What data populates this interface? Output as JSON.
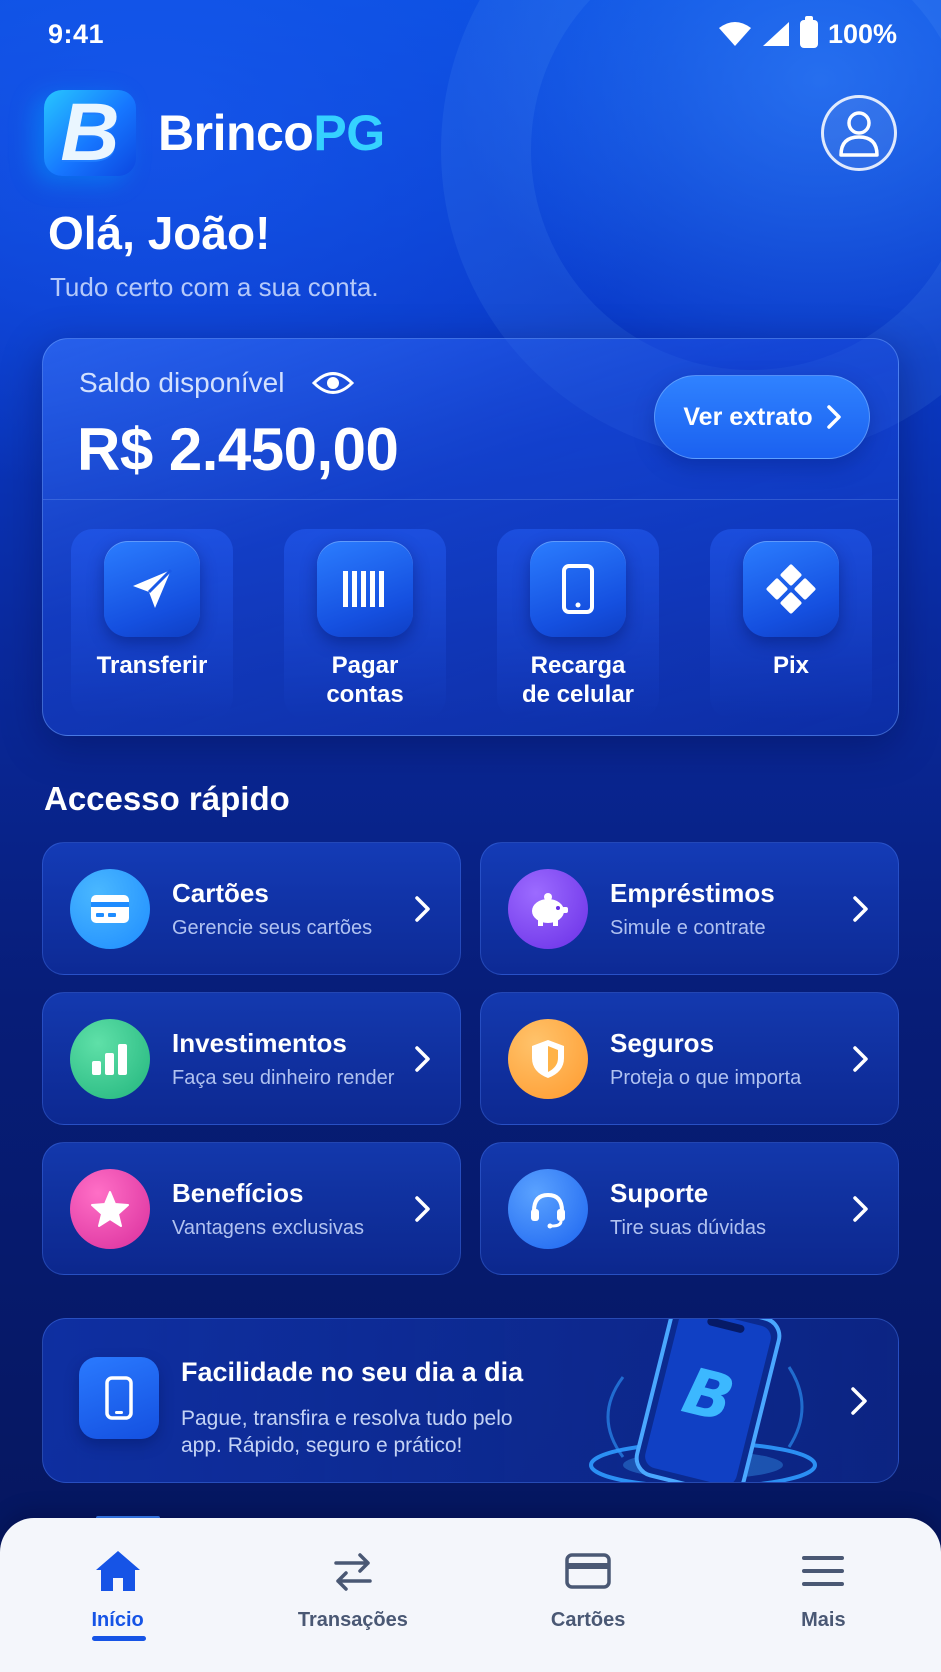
{
  "status_bar": {
    "time": "9:41",
    "battery": "100%"
  },
  "header": {
    "brand_main": "Brinco",
    "brand_accent": "PG",
    "logo_letter": "B"
  },
  "greeting": {
    "title": "Olá, João!",
    "subtitle": "Tudo certo com a sua conta."
  },
  "balance": {
    "label": "Saldo disponível",
    "value": "R$ 2.450,00",
    "statement_button": "Ver extrato"
  },
  "actions": [
    {
      "label": "Transferir",
      "icon": "send-icon"
    },
    {
      "label": "Pagar\ncontas",
      "icon": "barcode-icon"
    },
    {
      "label": "Recarga\nde celular",
      "icon": "phone-icon"
    },
    {
      "label": "Pix",
      "icon": "pix-icon"
    }
  ],
  "quick_access": {
    "title": "Accesso rápido",
    "items": [
      {
        "title": "Cartões",
        "subtitle": "Gerencie seus cartões",
        "icon": "card-icon",
        "color": "#1e9bff"
      },
      {
        "title": "Empréstimos",
        "subtitle": "Simule e contrate",
        "icon": "piggy-bank-icon",
        "color": "#7a3df0"
      },
      {
        "title": "Investimentos",
        "subtitle": "Faça seu dinheiro render",
        "icon": "bar-chart-icon",
        "color": "#2fc48c"
      },
      {
        "title": "Seguros",
        "subtitle": "Proteja o que importa",
        "icon": "shield-icon",
        "color": "#ffa63a"
      },
      {
        "title": "Benefícios",
        "subtitle": "Vantagens exclusivas",
        "icon": "star-icon",
        "color": "#e83aa8"
      },
      {
        "title": "Suporte",
        "subtitle": "Tire suas dúvidas",
        "icon": "headset-icon",
        "color": "#2d7bff"
      }
    ]
  },
  "banner": {
    "title": "Facilidade no seu dia a dia",
    "subtitle": "Pague, transfira e resolva tudo pelo app. Rápido, seguro e prático!"
  },
  "bottom_nav": [
    {
      "label": "Início",
      "icon": "home-icon",
      "active": true
    },
    {
      "label": "Transações",
      "icon": "transfer-arrows-icon",
      "active": false
    },
    {
      "label": "Cartões",
      "icon": "card-icon",
      "active": false
    },
    {
      "label": "Mais",
      "icon": "menu-icon",
      "active": false
    }
  ],
  "colors": {
    "primary": "#1654e6",
    "accent": "#35d2ff",
    "background": "#0a2a9e"
  }
}
